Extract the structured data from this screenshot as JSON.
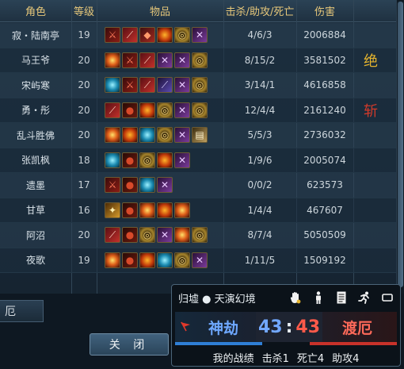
{
  "header": {
    "name": "角色",
    "level": "等级",
    "items": "物品",
    "kda": "击杀/助攻/死亡",
    "damage": "伤害"
  },
  "players": [
    {
      "name": "寂・陆南亭",
      "level": "19",
      "kda": "4/6/3",
      "damage": "2006884",
      "mark": "",
      "items": [
        "red-blade-icon",
        "scarlet-sword-icon",
        "red-boot-icon",
        "fire-orb-icon",
        "golden-ring-icon",
        "purple-amulet-icon"
      ]
    },
    {
      "name": "马王爷",
      "level": "20",
      "kda": "8/15/2",
      "damage": "3581502",
      "mark": "绝",
      "mark_color": "#e6b52e",
      "items": [
        "flame-gem-icon",
        "red-blade-icon",
        "scarlet-sword-icon",
        "purple-amulet-icon",
        "purple-amulet-icon",
        "golden-ring-icon"
      ]
    },
    {
      "name": "宋屿寒",
      "level": "20",
      "kda": "3/14/1",
      "damage": "4616858",
      "mark": "",
      "items": [
        "cyan-gem-icon",
        "red-blade-icon",
        "scarlet-sword-icon",
        "purple-sword-icon",
        "purple-amulet-icon",
        "golden-ring-icon"
      ]
    },
    {
      "name": "勇・彤",
      "level": "20",
      "kda": "12/4/4",
      "damage": "2161240",
      "mark": "斩",
      "mark_color": "#d23a2a",
      "items": [
        "scarlet-sword-icon",
        "red-gourd-icon",
        "fire-orb-icon",
        "golden-ring-icon",
        "purple-amulet-icon",
        "golden-ring-icon"
      ]
    },
    {
      "name": "乱斗胜佛",
      "level": "20",
      "kda": "5/5/3",
      "damage": "2736032",
      "mark": "",
      "items": [
        "flame-gem-icon",
        "fire-orb-icon",
        "cyan-gem-icon",
        "golden-ring-icon",
        "purple-amulet-icon",
        "scroll-icon"
      ]
    },
    {
      "name": "张凯枫",
      "level": "18",
      "kda": "1/9/6",
      "damage": "2005074",
      "mark": "",
      "items": [
        "cyan-gem-icon",
        "red-gourd-icon",
        "golden-ring-icon",
        "fire-orb-icon",
        "purple-amulet-icon"
      ]
    },
    {
      "name": "遗墨",
      "level": "17",
      "kda": "0/0/2",
      "damage": "623573",
      "mark": "",
      "items": [
        "red-blade-icon",
        "red-gourd-icon",
        "cyan-gem-icon",
        "purple-amulet-icon"
      ]
    },
    {
      "name": "甘草",
      "level": "16",
      "kda": "1/4/4",
      "damage": "467607",
      "mark": "",
      "items": [
        "golden-claw-icon",
        "red-gourd-icon",
        "flame-gem-icon",
        "fire-orb-icon",
        "flame-gem-icon"
      ]
    },
    {
      "name": "阿沼",
      "level": "20",
      "kda": "8/7/4",
      "damage": "5050509",
      "mark": "",
      "items": [
        "scarlet-sword-icon",
        "red-gourd-icon",
        "golden-ring-icon",
        "purple-amulet-icon",
        "flame-gem-icon",
        "golden-ring-icon"
      ]
    },
    {
      "name": "夜歌",
      "level": "19",
      "kda": "1/11/5",
      "damage": "1509192",
      "mark": "",
      "items": [
        "flame-gem-icon",
        "red-gourd-icon",
        "fire-orb-icon",
        "cyan-gem-icon",
        "golden-ring-icon",
        "purple-amulet-icon"
      ]
    }
  ],
  "team_tab": "厄",
  "close_label": "关 闭",
  "hud": {
    "title": "归墟 ● 天演幻境",
    "icons": [
      "hand-icon",
      "person-icon",
      "document-icon",
      "runner-icon",
      "minimize-icon"
    ],
    "team_left": "神劫",
    "team_right": "渡厄",
    "score_left": "43",
    "score_sep": ":",
    "score_right": "43",
    "stats_label": "我的战绩",
    "kills": "击杀1",
    "deaths": "死亡4",
    "assists": "助攻4"
  },
  "colors": {
    "header_text": "#e6c77a",
    "team_left": "#6ea8ff",
    "team_right": "#ff6a5a"
  }
}
